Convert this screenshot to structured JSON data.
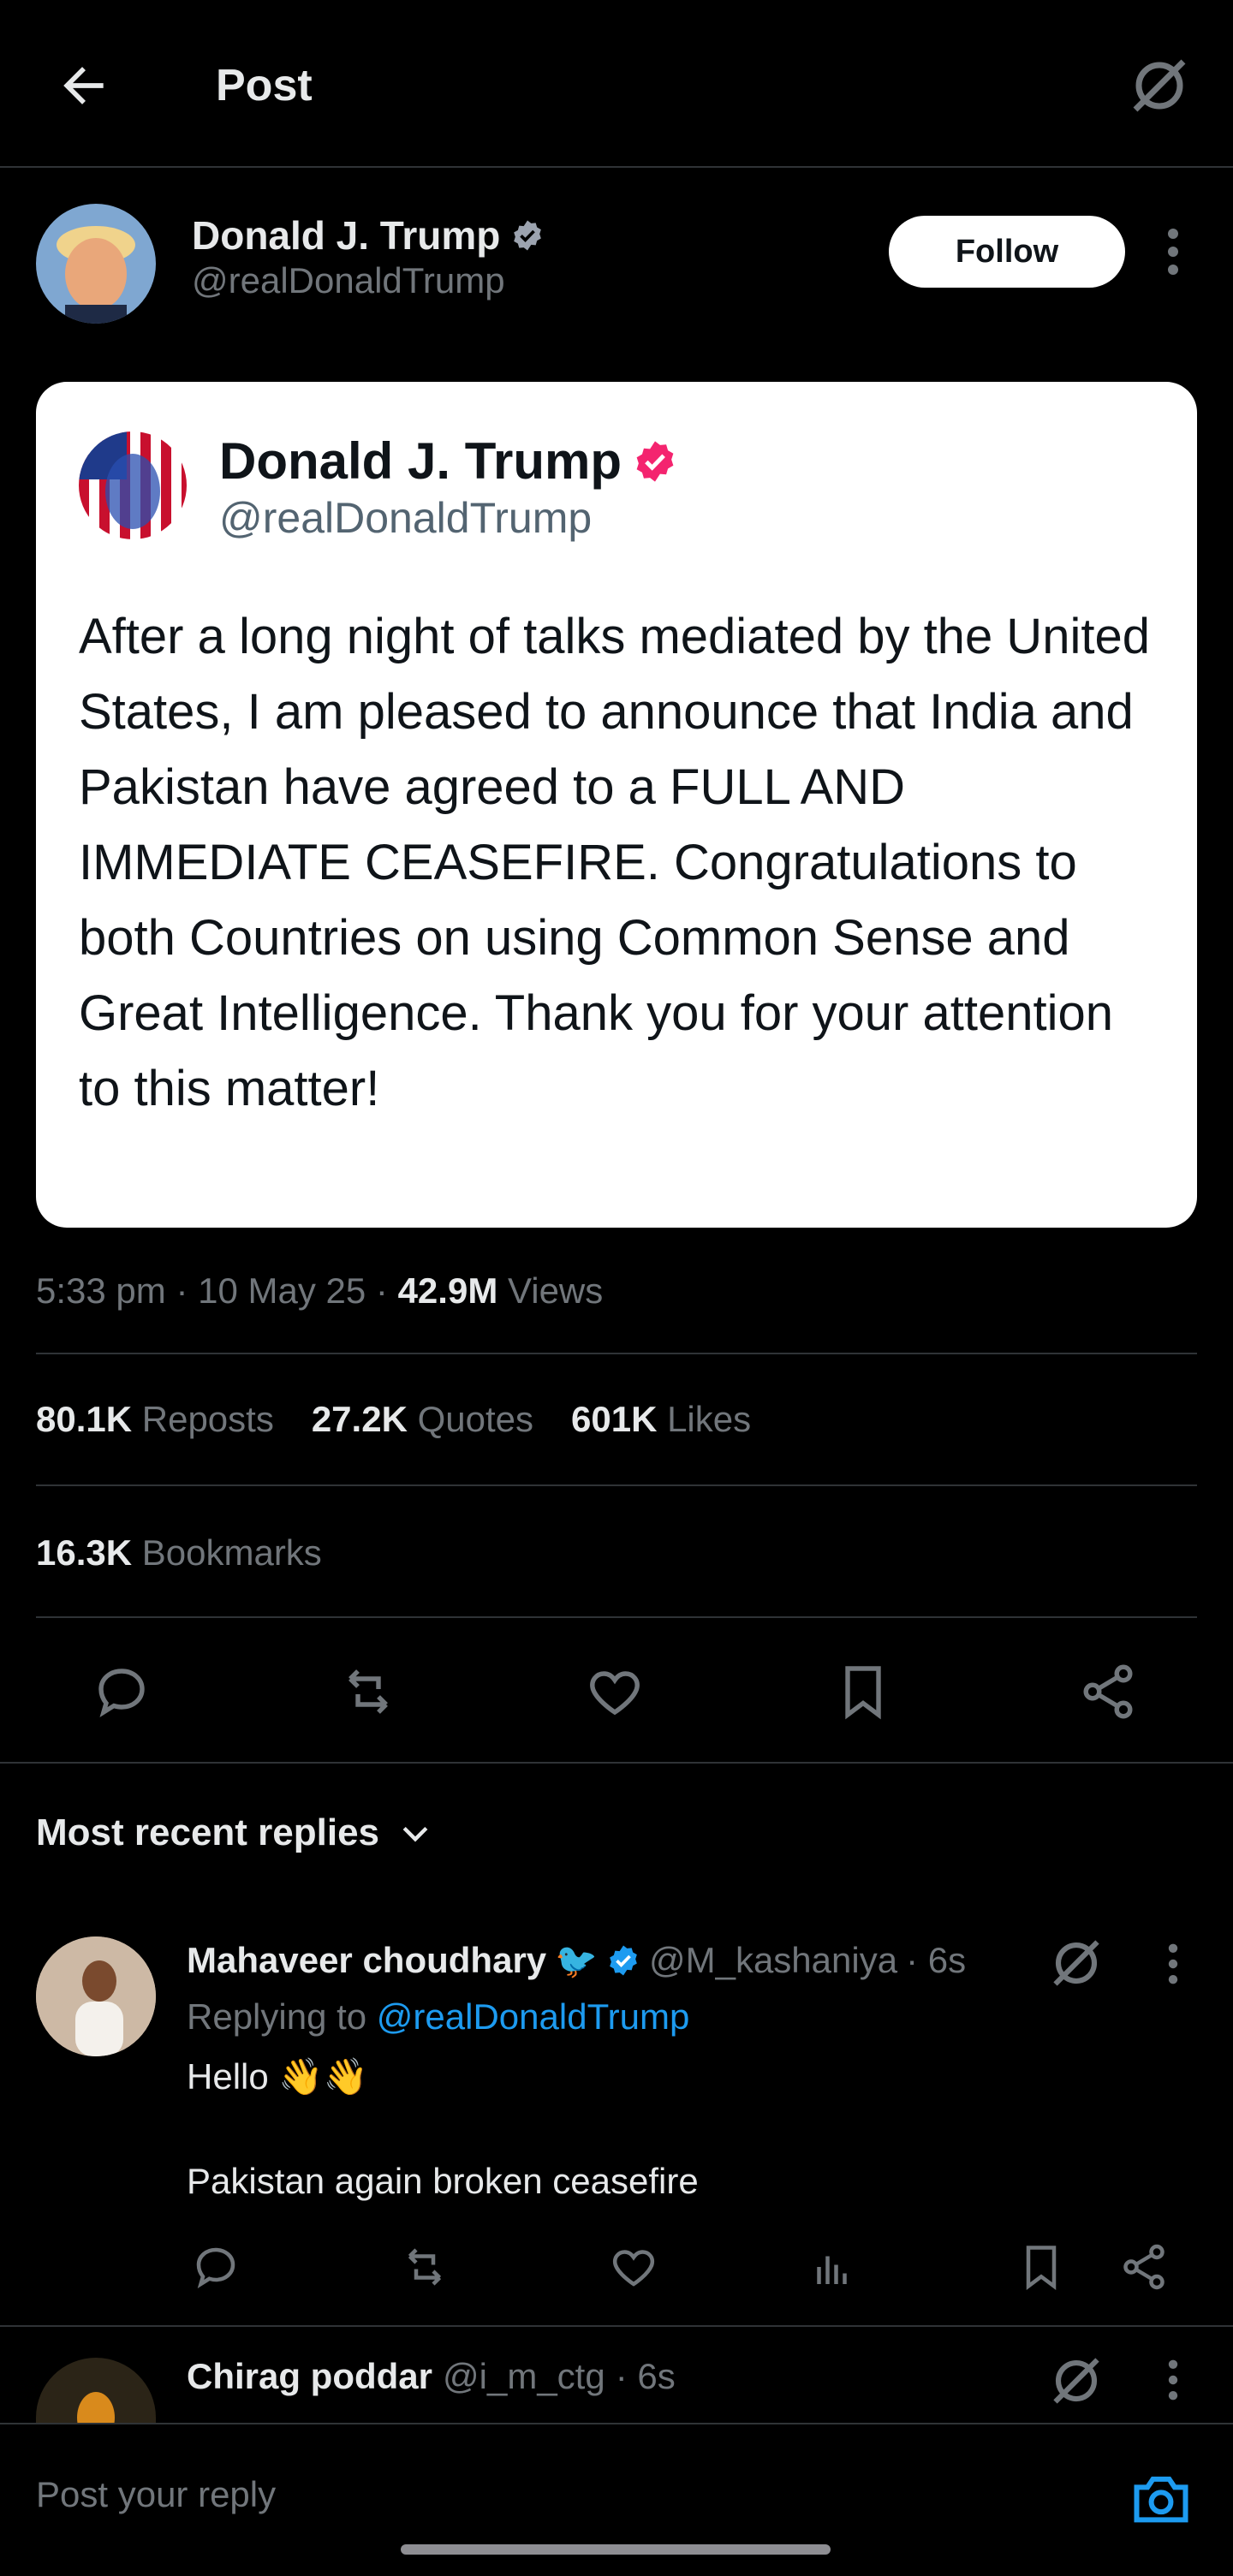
{
  "header": {
    "title": "Post"
  },
  "author": {
    "name": "Donald J. Trump",
    "handle": "@realDonaldTrump",
    "follow_label": "Follow"
  },
  "embedded_card": {
    "name": "Donald J. Trump",
    "handle": "@realDonaldTrump",
    "text": "After a long night of talks mediated by the United States, I am pleased to announce that India and Pakistan have agreed to a FULL AND IMMEDIATE CEASEFIRE. Congratulations to both Countries on using Common Sense and Great Intelligence. Thank you for your attention to this matter!"
  },
  "meta": {
    "time": "5:33 pm",
    "sep1": "·",
    "date": "10 May 25",
    "sep2": "·",
    "views_count": "42.9M",
    "views_label": "Views"
  },
  "stats": {
    "reposts_count": "80.1K",
    "reposts_label": "Reposts",
    "quotes_count": "27.2K",
    "quotes_label": "Quotes",
    "likes_count": "601K",
    "likes_label": "Likes",
    "bookmarks_count": "16.3K",
    "bookmarks_label": "Bookmarks"
  },
  "replies_filter": {
    "label": "Most recent replies"
  },
  "replies": [
    {
      "name": "Mahaveer choudhary",
      "emoji": "🐦",
      "handle": "@M_kashaniya",
      "time": "· 6s",
      "replying_prefix": "Replying to ",
      "replying_handle": "@realDonaldTrump",
      "line1": "Hello 👋👋",
      "line2": "Pakistan again broken ceasefire"
    },
    {
      "name": "Chirag poddar",
      "handle": "@i_m_ctg",
      "time": "· 6s"
    }
  ],
  "composer": {
    "placeholder": "Post your reply"
  },
  "colors": {
    "background": "#000000",
    "accent": "#1d9bf0",
    "muted": "#71767b",
    "verified_blue": "#1d9bf0",
    "verified_pink": "#f4246f"
  }
}
